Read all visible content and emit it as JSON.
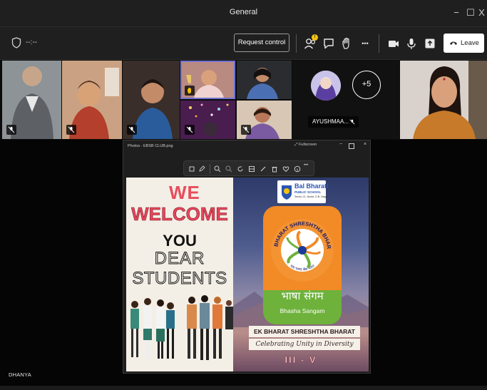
{
  "window": {
    "title": "General",
    "minimize": "−",
    "maximize": "☐",
    "close": "X"
  },
  "toolbar": {
    "timer": "--:--",
    "request_control_label": "Request control",
    "reactions_badge": "!",
    "leave_label": "Leave",
    "more_label": "•••"
  },
  "gallery": {
    "avatar_name": "AYUSHMAA...",
    "overflow_count": "+5"
  },
  "viewer": {
    "title": "Photos - EBSB CLUB.png",
    "fullscreen_label": "Fullscreen",
    "more_label": "•••"
  },
  "poster": {
    "we": "WE",
    "welcome": "WELCOME",
    "you": "YOU",
    "dear": "DEAR",
    "students": "STUDENTS",
    "school_name": "Bal Bharati",
    "school_sub": "PUBLIC SCHOOL",
    "school_addr": "Sector-21, Noida, G.B. Nagar",
    "ring_text": "EK BHARAT SHRESHTHA BHARAT",
    "hindi_motto": "एक भारत श्रेष्ठ भारत",
    "bhasha_hindi": "भाषा संगम",
    "bhasha_english": "Bhasha Sangam",
    "banner_title": "EK BHARAT SHRESHTHA BHARAT",
    "banner_tagline": "Celebrating Unity in Diversity",
    "grades": "III - V"
  },
  "presenter_label": "DHANYA",
  "colors": {
    "chrome": "#1f1f1f",
    "stage": "#050505",
    "poster_saffron": "#f28a26",
    "poster_green": "#6eb23b",
    "welcome_red": "#e8455a",
    "school_blue": "#2a56b0",
    "active_speaker": "#6f73d2"
  }
}
